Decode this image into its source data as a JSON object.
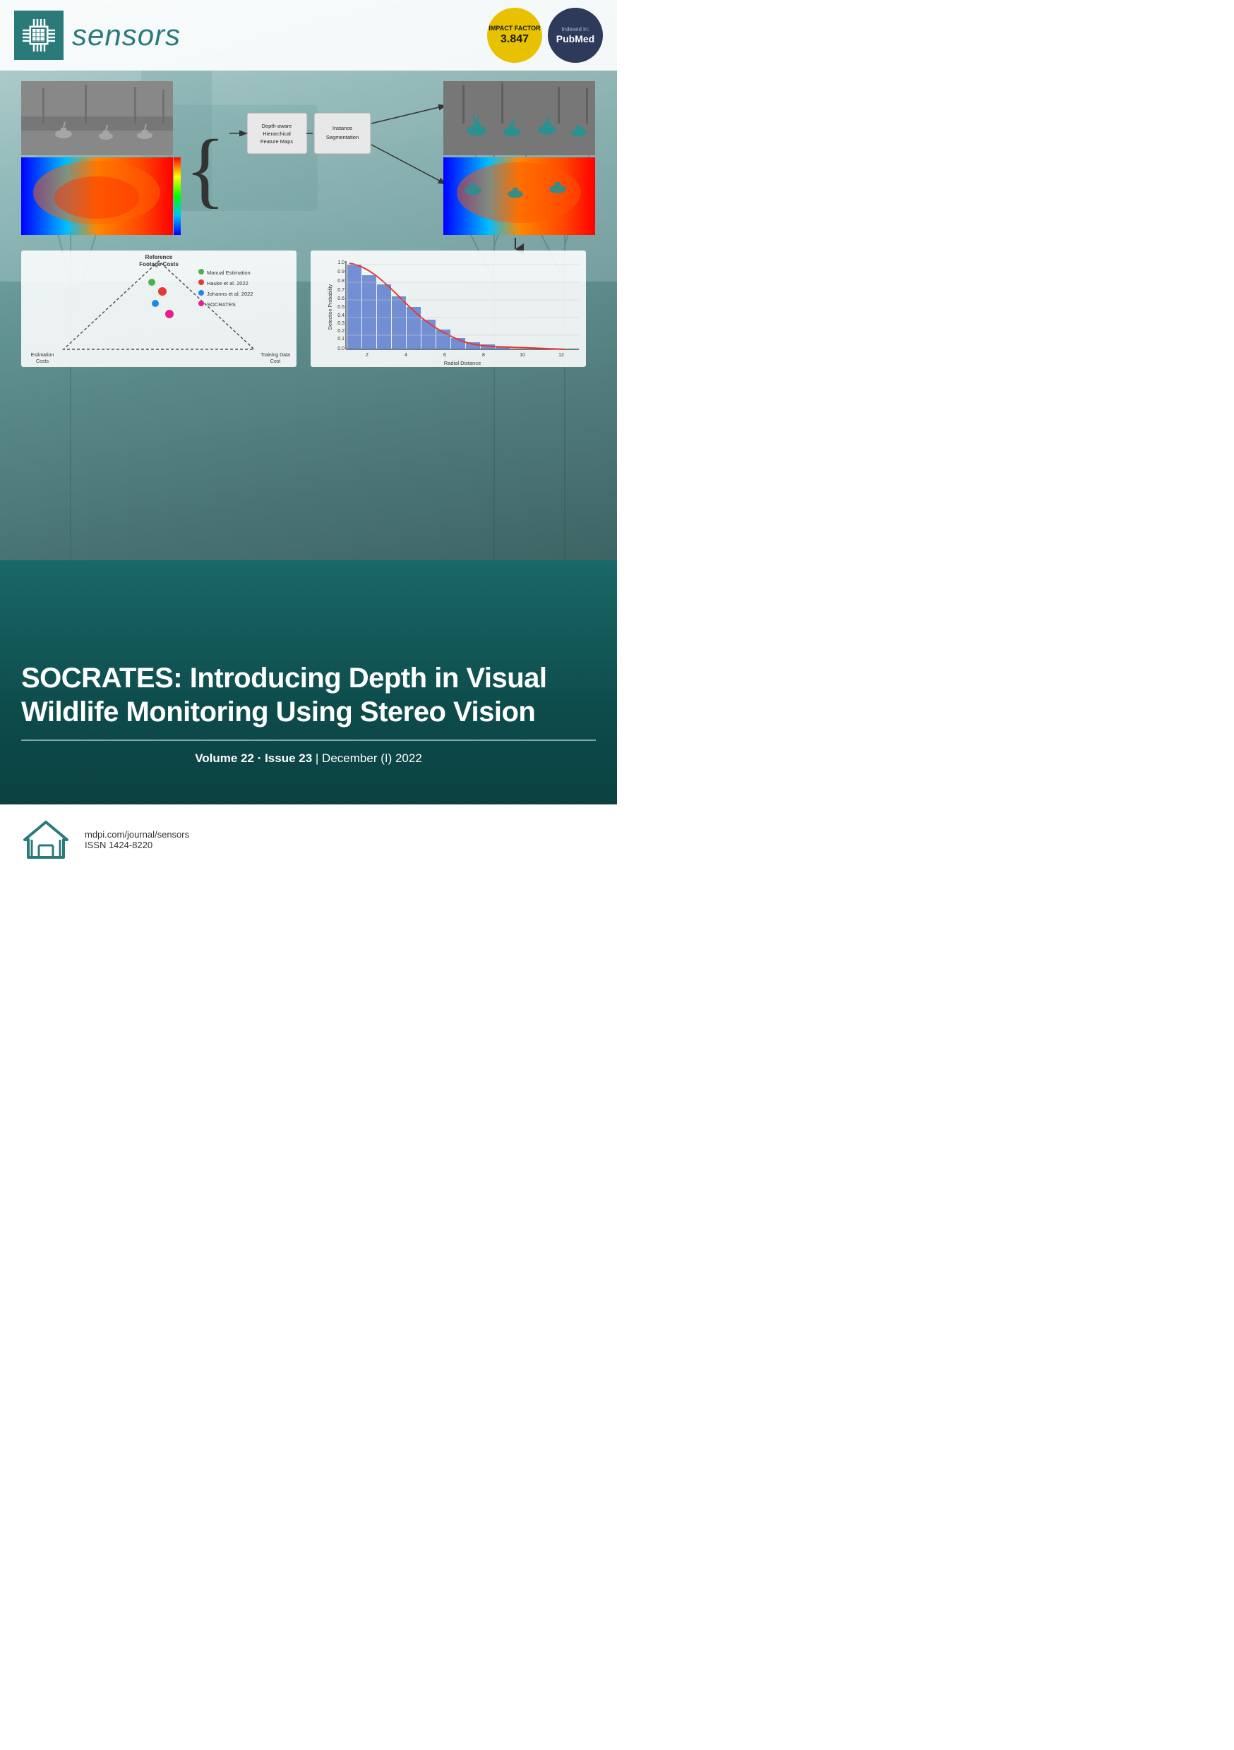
{
  "header": {
    "journal_name": "sensors",
    "logo_alt": "sensors chip logo"
  },
  "impact_badge": {
    "label": "IMPACT FACTOR",
    "number": "3.847"
  },
  "pubmed_badge": {
    "indexed_label": "Indexed in:",
    "name": "PubMed"
  },
  "diagram": {
    "box1_label": "Depth-aware Hierarchical Feature Maps",
    "box2_label": "Instance Segmentation"
  },
  "triangle_legend": {
    "items": [
      {
        "color": "#4caf50",
        "label": "Manual Estimation"
      },
      {
        "color": "#e53935",
        "label": "Hauke et al. 2022"
      },
      {
        "color": "#1e88e5",
        "label": "Johanns et al. 2022"
      },
      {
        "color": "#e91e8c",
        "label": "SOCRATES"
      }
    ],
    "vertex1": "Reference Footage Costs",
    "vertex2": "Estimation Costs",
    "vertex3": "Training Data Cost"
  },
  "histogram": {
    "x_label": "Radial Distance",
    "y_label": "Detection Probability",
    "y_max": "1.0",
    "y_ticks": [
      "0.0",
      "0.1",
      "0.2",
      "0.3",
      "0.4",
      "0.5",
      "0.6",
      "0.7",
      "0.8",
      "0.9",
      "1.0"
    ],
    "x_ticks": [
      "2",
      "4",
      "6",
      "8",
      "10",
      "12"
    ]
  },
  "title": {
    "main": "SOCRATES: Introducing Depth in Visual Wildlife Monitoring Using Stereo Vision"
  },
  "volume_info": {
    "text": "Volume 22 · Issue 23 | December (I) 2022",
    "volume": "Volume 22",
    "issue": "Issue 23",
    "date": "December (I) 2022"
  },
  "footer": {
    "website": "mdpi.com/journal/sensors",
    "issn": "ISSN 1424-8220",
    "mdpi_name": "MDPI"
  }
}
